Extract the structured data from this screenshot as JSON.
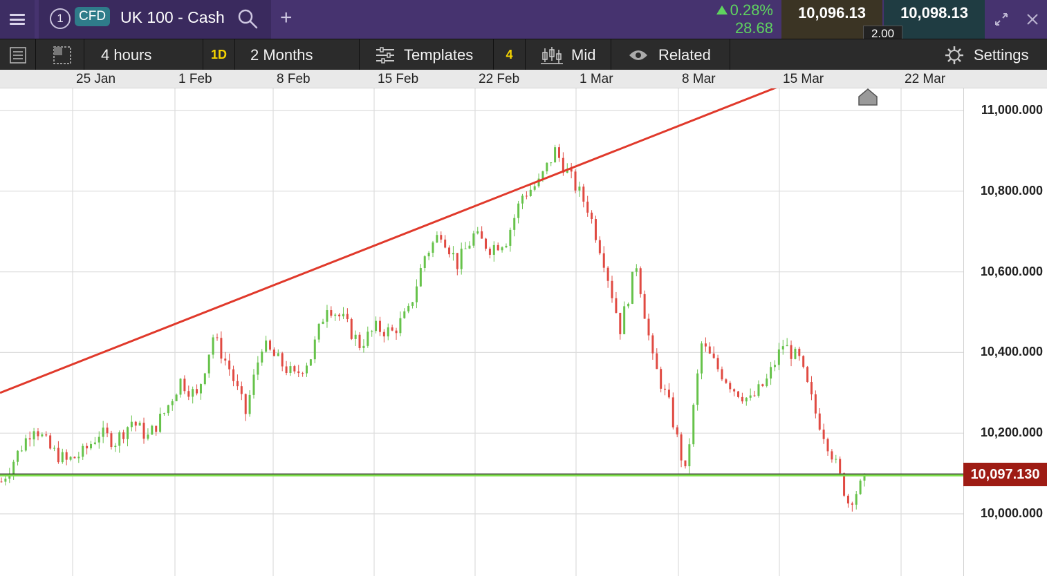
{
  "header": {
    "tab_number": "1",
    "instrument_type": "CFD",
    "market_name": "UK 100 - Cash",
    "change_percent": "0.28%",
    "change_points": "28.68",
    "sell_price": "10,096.13",
    "buy_price": "10,098.13",
    "spread": "2.00",
    "icons": [
      "menu-icon",
      "search-icon",
      "plus-icon",
      "expand-icon",
      "close-icon"
    ]
  },
  "toolbar": {
    "interval": "4 hours",
    "interval_badge": "1D",
    "period": "2 Months",
    "templates_label": "Templates",
    "templates_count": "4",
    "price_type": "Mid",
    "related_label": "Related",
    "settings_label": "Settings"
  },
  "colors": {
    "header_bg": "#46336f",
    "up": "#5fd45f",
    "candle_up": "#66c24a",
    "candle_down": "#e04a42",
    "trendline": "#e0392b",
    "support_line": "#7fe04b",
    "current_price_bg": "#9e1c14"
  },
  "chart_data": {
    "type": "candlestick",
    "x_tick_labels": [
      "25 Jan",
      "1 Feb",
      "8 Feb",
      "15 Feb",
      "22 Feb",
      "1 Mar",
      "8 Mar",
      "15 Mar",
      "22 Mar"
    ],
    "y_tick_labels": [
      "11,000.000",
      "10,800.000",
      "10,600.000",
      "10,400.000",
      "10,200.000",
      "10,000.000"
    ],
    "ylim": [
      9860,
      11060
    ],
    "current_price": "10,097.130",
    "current_price_value": 10097.13,
    "approx_close_path": [
      10080,
      10150,
      10220,
      10160,
      10130,
      10150,
      10200,
      10180,
      10230,
      10190,
      10250,
      10330,
      10290,
      10440,
      10360,
      10250,
      10420,
      10380,
      10340,
      10390,
      10520,
      10480,
      10420,
      10460,
      10450,
      10500,
      10640,
      10700,
      10620,
      10690,
      10660,
      10680,
      10790,
      10820,
      10900,
      10830,
      10760,
      10630,
      10460,
      10620,
      10380,
      10270,
      10100,
      10420,
      10360,
      10310,
      10280,
      10330,
      10420,
      10380,
      10250,
      10150,
      10030,
      10080
    ],
    "trendline": {
      "from": {
        "x": "start",
        "y": 10300
      },
      "to": {
        "x": "15 Mar",
        "y": 11060
      }
    },
    "support_line": 10097.13,
    "grid": true
  }
}
